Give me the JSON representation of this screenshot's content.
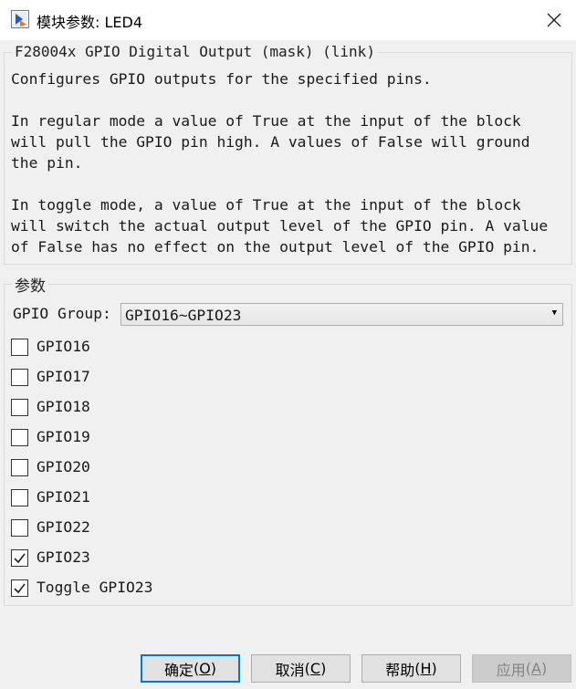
{
  "window": {
    "title": "模块参数: LED4",
    "close_icon": "close-icon"
  },
  "description": {
    "legend": "F28004x GPIO Digital Output (mask) (link)",
    "text": "Configures GPIO outputs for the specified pins.\n\nIn regular mode a value of True at the input of the block\nwill pull the GPIO pin high. A values of False will ground\nthe pin.\n\nIn toggle mode, a value of True at the input of the block\nwill switch the actual output level of the GPIO pin. A value\nof False has no effect on the output level of the GPIO pin."
  },
  "parameters": {
    "legend": "参数",
    "gpio_group": {
      "label": "GPIO Group:",
      "value": "GPIO16~GPIO23"
    },
    "checkboxes": [
      {
        "label": "GPIO16",
        "checked": false
      },
      {
        "label": "GPIO17",
        "checked": false
      },
      {
        "label": "GPIO18",
        "checked": false
      },
      {
        "label": "GPIO19",
        "checked": false
      },
      {
        "label": "GPIO20",
        "checked": false
      },
      {
        "label": "GPIO21",
        "checked": false
      },
      {
        "label": "GPIO22",
        "checked": false
      },
      {
        "label": "GPIO23",
        "checked": true
      },
      {
        "label": "Toggle GPIO23",
        "checked": true
      }
    ]
  },
  "buttons": {
    "ok": {
      "label": "确定",
      "key": "O"
    },
    "cancel": {
      "label": "取消",
      "key": "C"
    },
    "help": {
      "label": "帮助",
      "key": "H"
    },
    "apply": {
      "label": "应用",
      "key": "A",
      "enabled": false
    }
  },
  "colors": {
    "accent": "#0078d7",
    "window_bg": "#f0f0f0"
  }
}
